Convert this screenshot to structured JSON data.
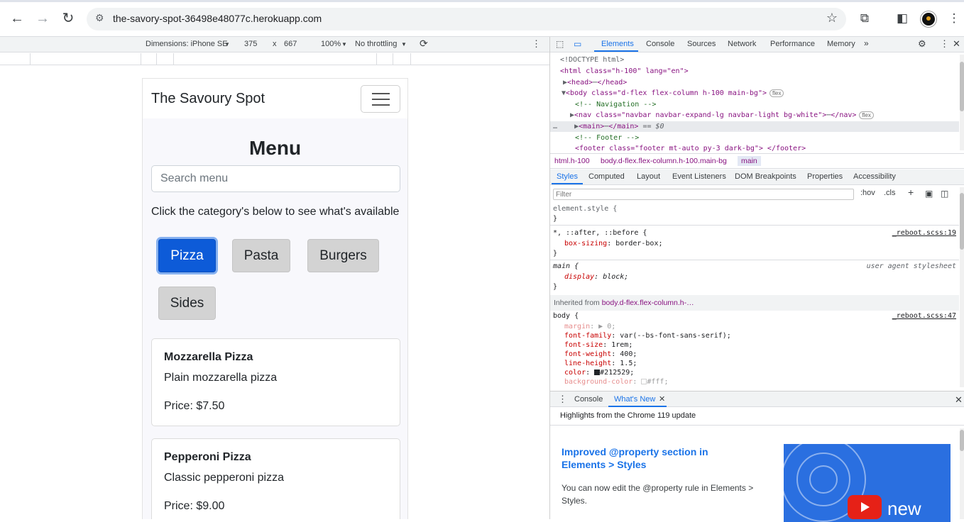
{
  "browser": {
    "url": "the-savory-spot-36498e48077c.herokuapp.com",
    "icons": [
      "back-icon",
      "forward-icon",
      "reload-icon",
      "tune-icon",
      "star-icon",
      "extensions-icon",
      "side-panel-icon",
      "profile-avatar",
      "more-icon"
    ]
  },
  "device_toolbar": {
    "dimensions_label": "Dimensions: iPhone SE",
    "width": "375",
    "times": "x",
    "height": "667",
    "zoom": "100%",
    "throttling": "No throttling"
  },
  "site": {
    "brand": "The Savoury Spot",
    "menu_title": "Menu",
    "search_placeholder": "Search menu",
    "hint": "Click the category's below to see what's available",
    "categories": [
      {
        "label": "Pizza",
        "active": true
      },
      {
        "label": "Pasta",
        "active": false
      },
      {
        "label": "Burgers",
        "active": false
      },
      {
        "label": "Sides",
        "active": false
      }
    ],
    "items": [
      {
        "name": "Mozzarella Pizza",
        "desc": "Plain mozzarella pizza",
        "price": "Price: $7.50"
      },
      {
        "name": "Pepperoni Pizza",
        "desc": "Classic pepperoni pizza",
        "price": "Price: $9.00"
      }
    ]
  },
  "devtools": {
    "tabs": [
      "Elements",
      "Console",
      "Sources",
      "Network",
      "Performance",
      "Memory"
    ],
    "active_tab": "Elements",
    "dom": {
      "doctype": "<!DOCTYPE html>",
      "html_open": "<html class=\"h-100\" lang=\"en\">",
      "head": "<head>",
      "head_close": "</head>",
      "body": "<body class=\"d-flex flex-column h-100 main-bg\">",
      "comment_nav": "<!-- Navigation -->",
      "nav": "<nav class=\"navbar navbar-expand-lg navbar-light bg-white\">",
      "nav_close": "</nav>",
      "main": "<main>",
      "main_close": "</main>",
      "main_eq": "== $0",
      "comment_footer": "<!-- Footer -->",
      "footer": "<footer class=\"footer mt-auto py-3 dark-bg\"> </footer>",
      "flex_badge": "flex"
    },
    "breadcrumbs": [
      "html.h-100",
      "body.d-flex.flex-column.h-100.main-bg",
      "main"
    ],
    "style_tabs": [
      "Styles",
      "Computed",
      "Layout",
      "Event Listeners",
      "DOM Breakpoints",
      "Properties",
      "Accessibility"
    ],
    "filter_placeholder": "Filter",
    "filter_buttons": [
      ":hov",
      ".cls",
      "+"
    ],
    "styles": {
      "element_style": "element.style {",
      "close": "}",
      "universal": "*, ::after, ::before {",
      "universal_src": "_reboot.scss:19",
      "box_sizing_prop": "box-sizing",
      "box_sizing_val": "border-box;",
      "main_rule": "main {",
      "main_src": "user agent stylesheet",
      "display_prop": "display",
      "display_val": "block;",
      "inherited_label": "Inherited from",
      "inherited_from": "body.d-flex.flex-column.h-…",
      "body_rule": "body {",
      "body_src": "_reboot.scss:47",
      "props": [
        {
          "p": "margin",
          "v": "▶ 0;",
          "faded": true
        },
        {
          "p": "font-family",
          "v": "var(--bs-font-sans-serif);",
          "faded": false
        },
        {
          "p": "font-size",
          "v": "1rem;",
          "faded": false
        },
        {
          "p": "font-weight",
          "v": "400;",
          "faded": false
        },
        {
          "p": "line-height",
          "v": "1.5;",
          "faded": false
        },
        {
          "p": "color",
          "v": "#212529;",
          "faded": false
        },
        {
          "p": "background-color",
          "v": "#fff;",
          "faded": true
        }
      ]
    },
    "drawer": {
      "tabs": [
        "Console",
        "What's New"
      ],
      "active": "What's New",
      "highlights": "Highlights from the Chrome 119 update",
      "title": "Improved @property section in Elements > Styles",
      "body": "You can now edit the @property rule in Elements > Styles.",
      "video_word": "new"
    }
  }
}
